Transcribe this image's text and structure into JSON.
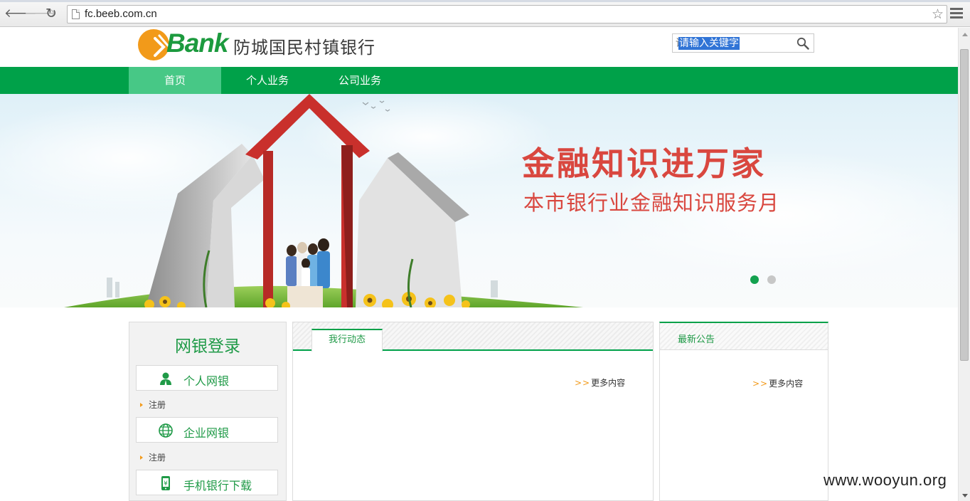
{
  "browser": {
    "back_glyph": "🡐",
    "forward_glyph": "🡒",
    "reload_glyph": "↻",
    "url": "fc.beeb.com.cn",
    "star_glyph": "☆"
  },
  "header": {
    "logo_word": "Bank",
    "bank_name": "防城国民村镇银行",
    "search_placeholder": "请输入关键字"
  },
  "nav": {
    "items": [
      {
        "label": "首页",
        "active": true
      },
      {
        "label": "个人业务",
        "active": false
      },
      {
        "label": "公司业务",
        "active": false
      }
    ]
  },
  "banner": {
    "title": "金融知识进万家",
    "subtitle": "本市银行业金融知识服务月",
    "dots": [
      {
        "active": true,
        "color": "#13a14f"
      },
      {
        "active": false,
        "color": "#c7c7c7"
      }
    ]
  },
  "login": {
    "title": "网银登录",
    "personal_label": "个人网银",
    "register1": "注册",
    "corporate_label": "企业网银",
    "register2": "注册",
    "mobile_label": "手机银行下载"
  },
  "news": {
    "tab_label": "我行动态",
    "more_prefix": ">>",
    "more_label": "更多内容"
  },
  "notice": {
    "title": "最新公告",
    "more_prefix": ">>",
    "more_label": "更多内容"
  },
  "watermark": "www.wooyun.org",
  "colors": {
    "brand_green": "#00a149",
    "nav_active": "#47c886",
    "banner_red": "#d9473f",
    "logo_orange": "#f29a1a",
    "selection_blue": "#3074d6"
  }
}
